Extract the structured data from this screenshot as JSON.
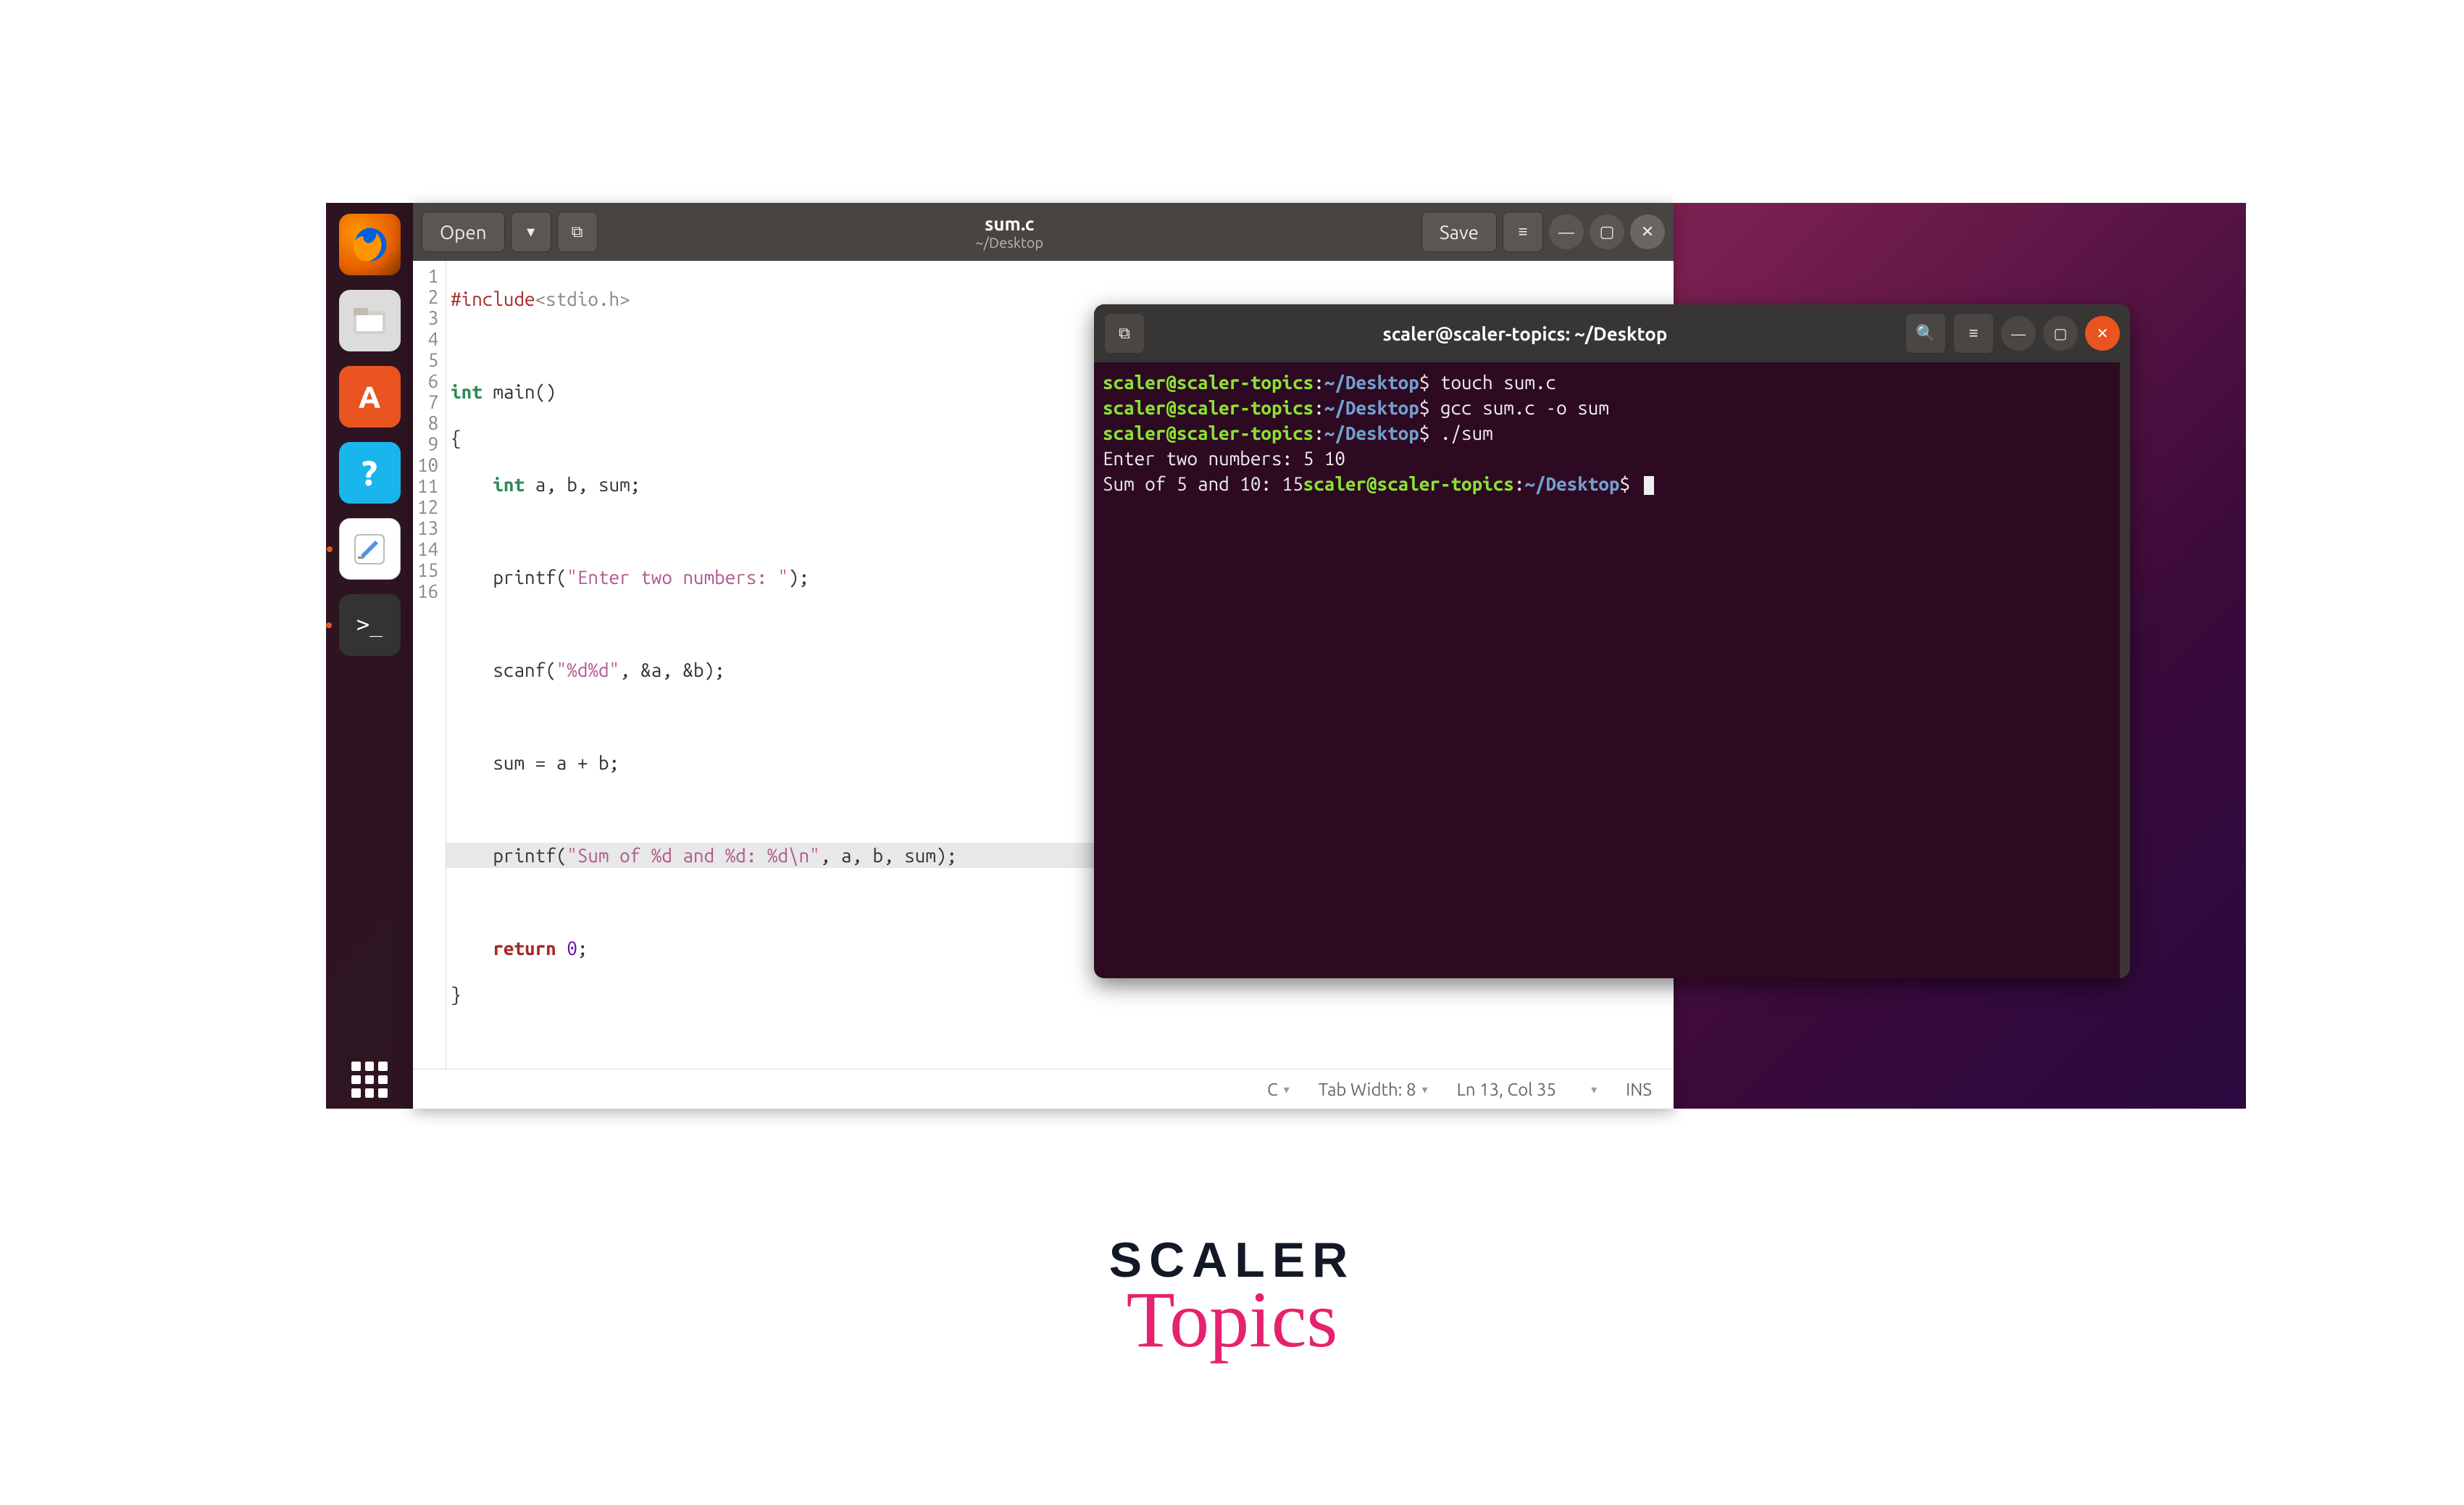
{
  "dock": {
    "items": [
      {
        "name": "firefox",
        "label": "🔥"
      },
      {
        "name": "files",
        "label": "🗂"
      },
      {
        "name": "software",
        "label": "A"
      },
      {
        "name": "help",
        "label": "?"
      },
      {
        "name": "gedit",
        "label": "✎"
      },
      {
        "name": "terminal",
        "label": ">_"
      }
    ]
  },
  "gedit": {
    "open_label": "Open",
    "save_label": "Save",
    "title": "sum.c",
    "subtitle": "~/Desktop",
    "line_numbers": [
      "1",
      "2",
      "3",
      "4",
      "5",
      "6",
      "7",
      "8",
      "9",
      "10",
      "11",
      "12",
      "13",
      "14",
      "15",
      "16"
    ],
    "code": {
      "l1_include": "#include",
      "l1_lib": "<stdio.h>",
      "l3_kw": "int",
      "l3_rest": " main()",
      "l4": "{",
      "l5_type": "int",
      "l5_rest": " a, b, sum;",
      "l7_a": "    printf(",
      "l7_str": "\"Enter two numbers: \"",
      "l7_b": ");",
      "l9_a": "    scanf(",
      "l9_str": "\"%d%d\"",
      "l9_b": ", &a, &b);",
      "l11": "    sum = a + b;",
      "l13_a": "    printf(",
      "l13_str": "\"Sum of %d and %d: %d\\n\"",
      "l13_b": ", a, b, sum);",
      "l15_kw": "return",
      "l15_num": "0",
      "l15_rest": ";",
      "l16": "}"
    },
    "status": {
      "language": "C",
      "tab_width": "Tab Width: 8",
      "cursor_pos": "Ln 13, Col 35",
      "insert_mode": "INS"
    }
  },
  "terminal": {
    "title": "scaler@scaler-topics: ~/Desktop",
    "prompt_user": "scaler@scaler-topics",
    "prompt_path": "~/Desktop",
    "prompt_sep1": ":",
    "prompt_sep2": "$",
    "cmds": {
      "c1": "touch sum.c",
      "c2": "gcc sum.c -o sum",
      "c3": "./sum"
    },
    "output": {
      "o1": "Enter two numbers: 5 10",
      "o2_prefix": "Sum of 5 and 10: 15"
    }
  },
  "logo": {
    "line1": "SCALER",
    "line2": "Topics"
  }
}
